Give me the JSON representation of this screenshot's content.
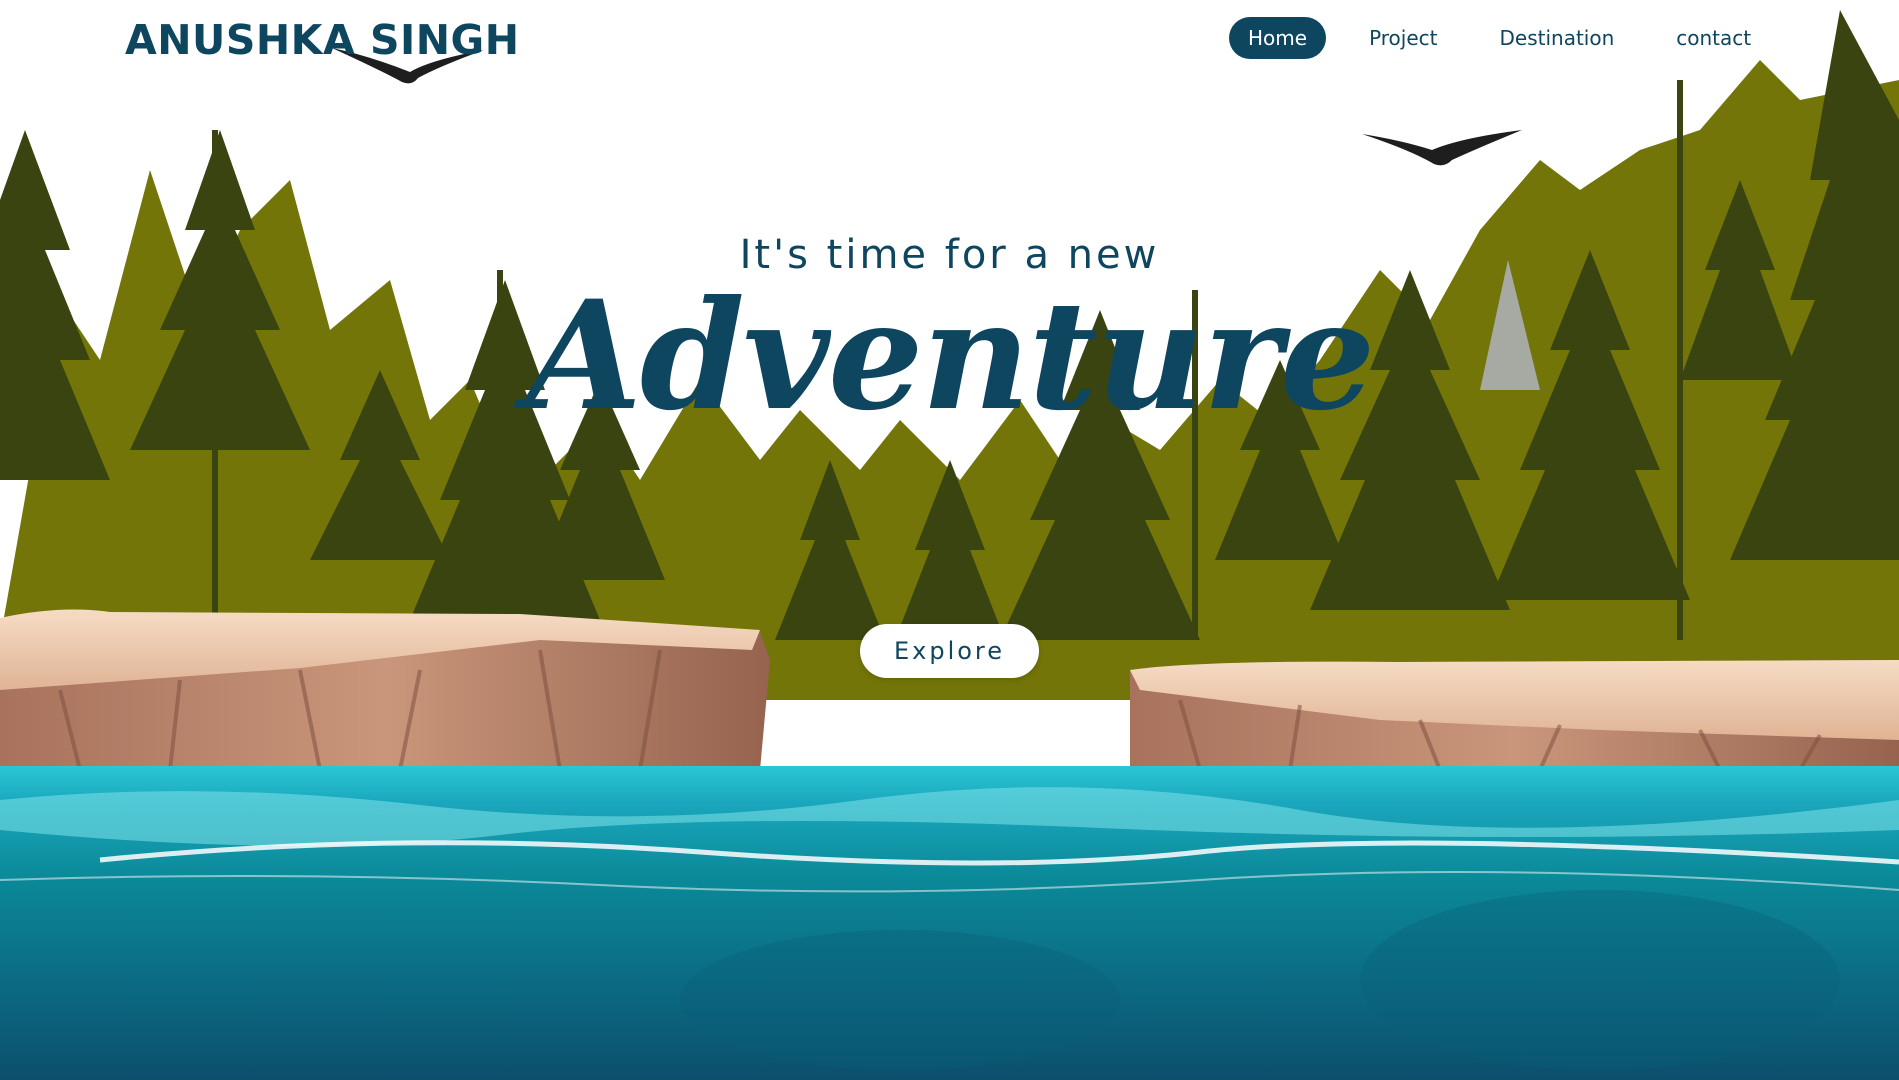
{
  "brand": {
    "name": "ANUSHKA SINGH"
  },
  "nav": {
    "items": [
      {
        "label": "Home",
        "active": true
      },
      {
        "label": "Project",
        "active": false
      },
      {
        "label": "Destination",
        "active": false
      },
      {
        "label": "contact",
        "active": false
      }
    ]
  },
  "hero": {
    "subtitle": "It's time for a new",
    "title": "Adventure",
    "cta_label": "Explore"
  },
  "colors": {
    "primary": "#0e4660",
    "tree_dark": "#3a4410",
    "tree_olive": "#737509",
    "cliff": "#c08f76",
    "water": "#0c8a9a"
  },
  "icons": [
    "eagle-icon",
    "eagle-icon"
  ]
}
